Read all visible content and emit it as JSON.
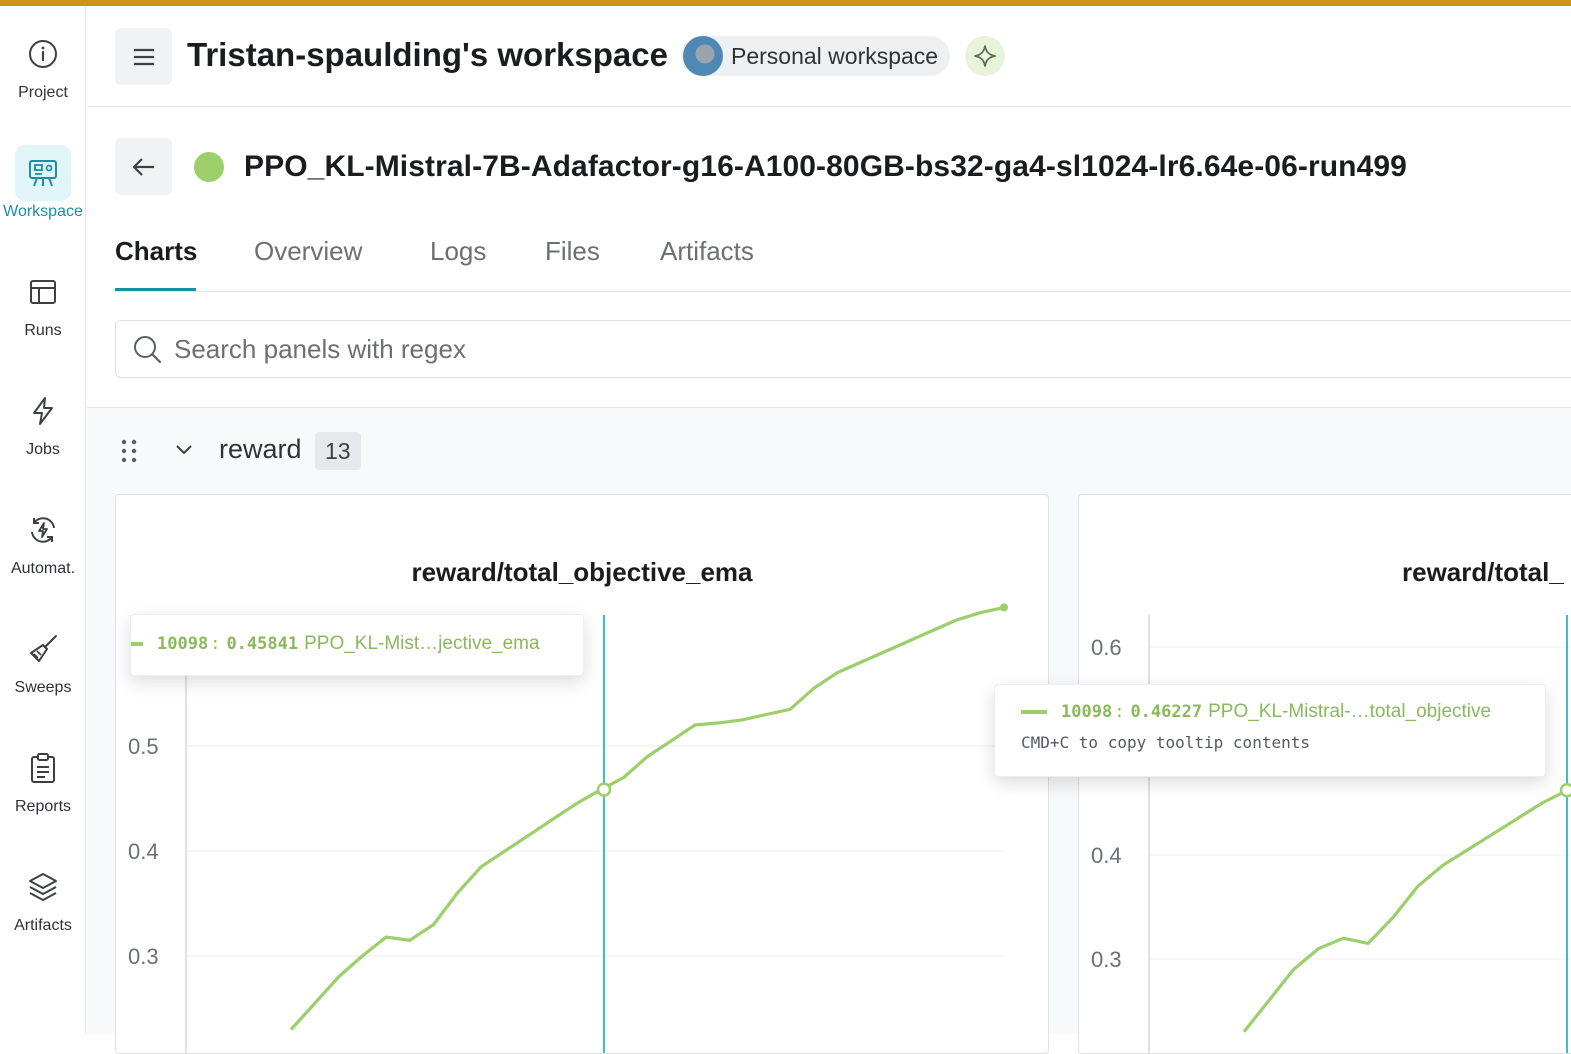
{
  "sidebar": {
    "items": [
      {
        "label": "Project",
        "icon": "info-icon"
      },
      {
        "label": "Workspace",
        "icon": "workspace-icon",
        "active": true
      },
      {
        "label": "Runs",
        "icon": "table-icon"
      },
      {
        "label": "Jobs",
        "icon": "lightning-icon"
      },
      {
        "label": "Automat.",
        "icon": "automation-icon"
      },
      {
        "label": "Sweeps",
        "icon": "broom-icon"
      },
      {
        "label": "Reports",
        "icon": "clipboard-icon"
      },
      {
        "label": "Artifacts",
        "icon": "layers-icon"
      }
    ]
  },
  "header": {
    "workspace_title": "Tristan-spaulding's workspace",
    "workspace_pill": "Personal workspace"
  },
  "run": {
    "name": "PPO_KL-Mistral-7B-Adafactor-g16-A100-80GB-bs32-ga4-sl1024-lr6.64e-06-run499",
    "status_color": "#9cce6a"
  },
  "tabs": [
    {
      "label": "Charts",
      "active": true
    },
    {
      "label": "Overview"
    },
    {
      "label": "Logs"
    },
    {
      "label": "Files"
    },
    {
      "label": "Artifacts"
    }
  ],
  "search": {
    "placeholder": "Search panels with regex",
    "value": ""
  },
  "section": {
    "title": "reward",
    "count": "13"
  },
  "colors": {
    "accent": "#1b8fa6",
    "series": "#9cce6a",
    "top_stripe": "#d39316"
  },
  "panels": [
    {
      "title": "reward/total_objective_ema",
      "tooltip": {
        "step": "10098",
        "value": "0.45841",
        "series": "PPO_KL-Mist…jective_ema"
      }
    },
    {
      "title": "reward/total_",
      "tooltip": {
        "step": "10098",
        "value": "0.46227",
        "series": "PPO_KL-Mistral-…total_objective",
        "hint": "CMD+C to copy tooltip contents"
      }
    }
  ],
  "chart_data": [
    {
      "type": "line",
      "title": "reward/total_objective_ema",
      "ytick_labels": [
        "0.5",
        "0.4",
        "0.3"
      ],
      "ylim": [
        0.23,
        0.64
      ],
      "series": [
        {
          "name": "PPO_KL-Mist…jective_ema",
          "color": "#9cce6a",
          "values": [
            0.23,
            0.255,
            0.28,
            0.3,
            0.318,
            0.315,
            0.33,
            0.36,
            0.385,
            0.4,
            0.415,
            0.43,
            0.445,
            0.458,
            0.47,
            0.49,
            0.505,
            0.52,
            0.522,
            0.525,
            0.53,
            0.535,
            0.555,
            0.57,
            0.58,
            0.59,
            0.6,
            0.61,
            0.62,
            0.627,
            0.632
          ]
        }
      ],
      "hover_value": 0.45841
    },
    {
      "type": "line",
      "title": "reward/total_",
      "ytick_labels": [
        "0.6",
        "0.4",
        "0.3"
      ],
      "ylim": [
        0.23,
        0.64
      ],
      "series": [
        {
          "name": "PPO_KL-Mistral-…total_objective",
          "color": "#9cce6a",
          "values": [
            0.23,
            0.26,
            0.29,
            0.31,
            0.32,
            0.315,
            0.34,
            0.37,
            0.39,
            0.405,
            0.42,
            0.435,
            0.45,
            0.462
          ]
        }
      ],
      "hover_value": 0.46227
    }
  ]
}
